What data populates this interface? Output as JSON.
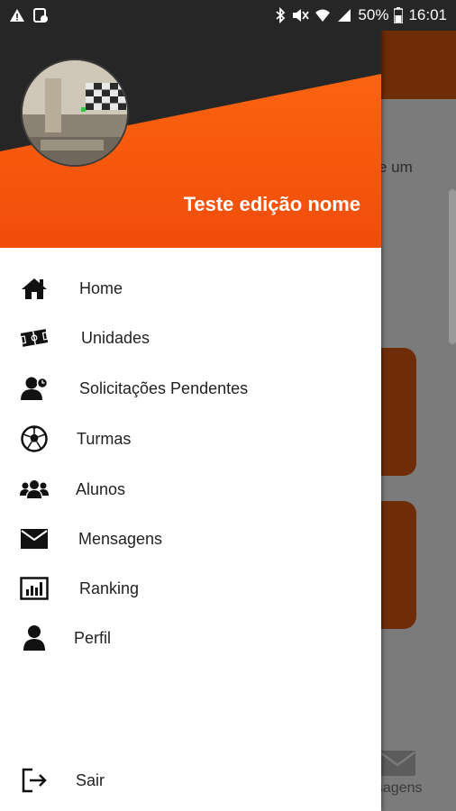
{
  "status_bar": {
    "battery": "50%",
    "time": "16:01"
  },
  "background_app": {
    "partial_text": "e um",
    "bottom_tab_label": "nsagens"
  },
  "drawer": {
    "user_name": "Teste edição nome",
    "menu_items": [
      {
        "label": "Home",
        "icon": "home-icon"
      },
      {
        "label": "Unidades",
        "icon": "field-icon"
      },
      {
        "label": "Solicitações Pendentes",
        "icon": "user-clock-icon"
      },
      {
        "label": "Turmas",
        "icon": "soccer-ball-icon"
      },
      {
        "label": "Alunos",
        "icon": "users-icon"
      },
      {
        "label": "Mensagens",
        "icon": "envelope-icon"
      },
      {
        "label": "Ranking",
        "icon": "bar-chart-icon"
      },
      {
        "label": "Perfil",
        "icon": "user-icon"
      }
    ],
    "logout_label": "Sair"
  },
  "colors": {
    "header_orange": "#ff5a0e",
    "header_dark": "#2b2b2b",
    "topbar_dim": "#6e2c07"
  }
}
